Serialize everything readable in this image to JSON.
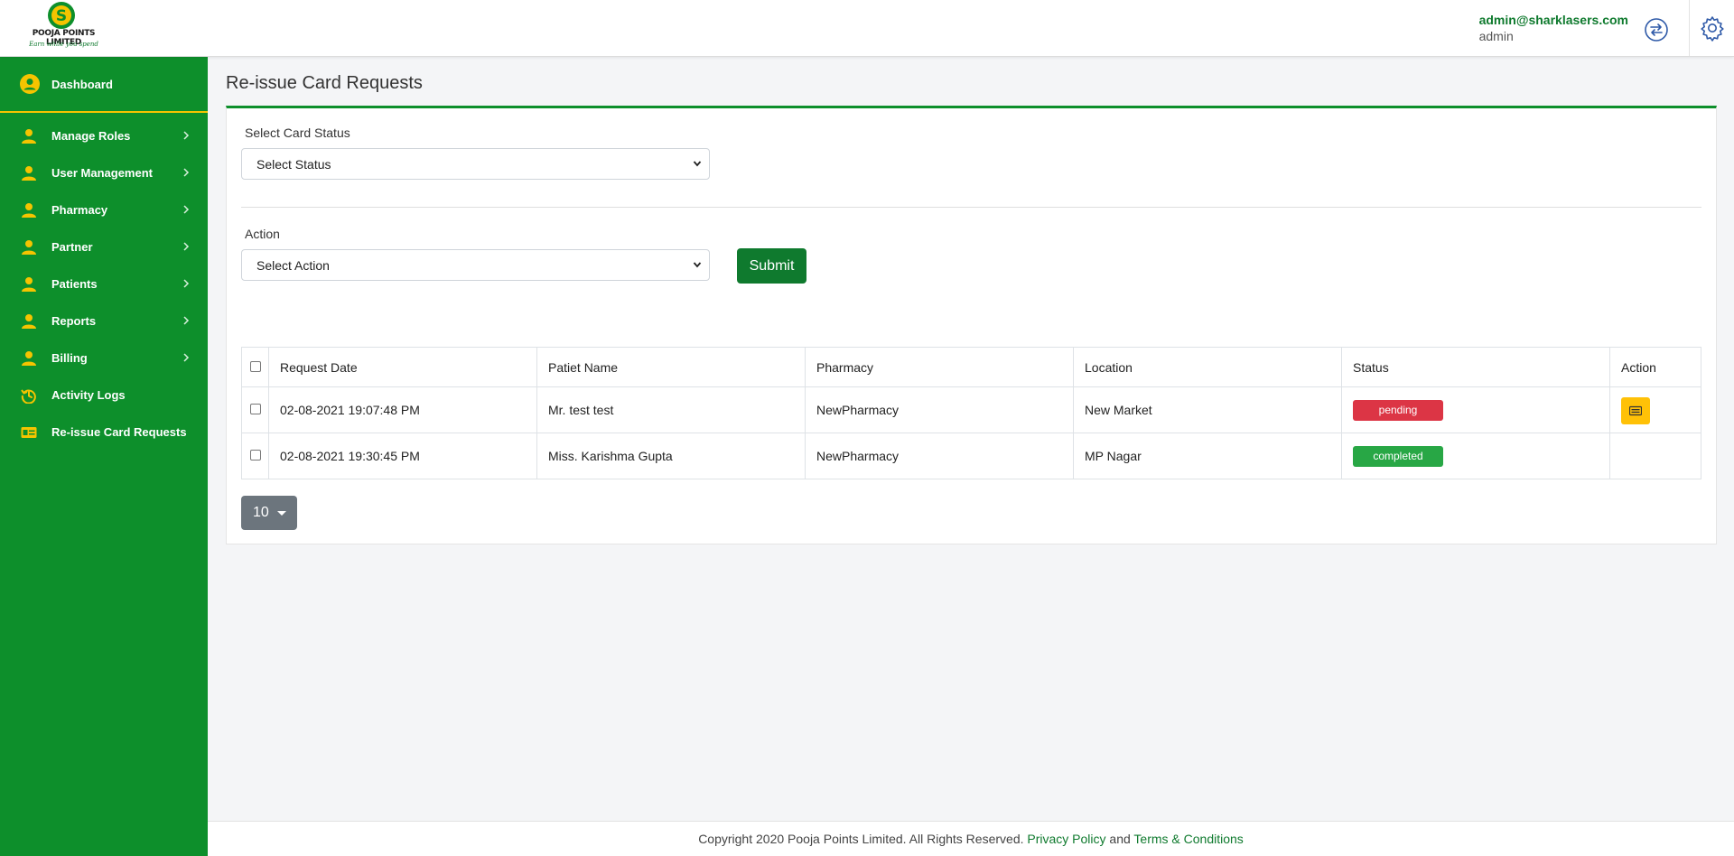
{
  "header": {
    "logo_text": "POOJA POINTS LIMITED",
    "logo_tagline": "Earn while you spend",
    "user_email": "admin@sharklasers.com",
    "user_role": "admin"
  },
  "sidebar": {
    "dashboard": {
      "label": "Dashboard",
      "icon": "user-circle-icon"
    },
    "items": [
      {
        "label": "Manage Roles",
        "icon": "user-icon",
        "has_submenu": true
      },
      {
        "label": "User Management",
        "icon": "user-icon",
        "has_submenu": true
      },
      {
        "label": "Pharmacy",
        "icon": "user-icon",
        "has_submenu": true
      },
      {
        "label": "Partner",
        "icon": "user-icon",
        "has_submenu": true
      },
      {
        "label": "Patients",
        "icon": "user-icon",
        "has_submenu": true
      },
      {
        "label": "Reports",
        "icon": "user-icon",
        "has_submenu": true
      },
      {
        "label": "Billing",
        "icon": "user-icon",
        "has_submenu": true
      },
      {
        "label": "Activity Logs",
        "icon": "history-icon",
        "has_submenu": false
      },
      {
        "label": "Re-issue Card Requests",
        "icon": "id-card-icon",
        "has_submenu": false
      }
    ]
  },
  "main": {
    "title": "Re-issue Card Requests",
    "status_filter": {
      "label": "Select Card Status",
      "value": "Select Status"
    },
    "action_filter": {
      "label": "Action",
      "value": "Select Action"
    },
    "submit_label": "Submit",
    "table": {
      "columns": [
        "Request Date",
        "Patiet Name",
        "Pharmacy",
        "Location",
        "Status",
        "Action"
      ],
      "rows": [
        {
          "date": "02-08-2021 19:07:48 PM",
          "name": "Mr. test test",
          "pharmacy": "NewPharmacy",
          "location": "New Market",
          "status": "pending",
          "has_action": true
        },
        {
          "date": "02-08-2021 19:30:45 PM",
          "name": "Miss. Karishma Gupta",
          "pharmacy": "NewPharmacy",
          "location": "MP Nagar",
          "status": "completed",
          "has_action": false
        }
      ]
    },
    "page_size": "10"
  },
  "footer": {
    "copyright": "Copyright 2020 Pooja Points Limited. All Rights Reserved.",
    "privacy": "Privacy Policy",
    "and": "and",
    "terms": "Terms & Conditions"
  },
  "colors": {
    "brand_green": "#0d8f2b",
    "accent_yellow": "#f5c400",
    "pending": "#dc3545",
    "completed": "#28a745"
  }
}
